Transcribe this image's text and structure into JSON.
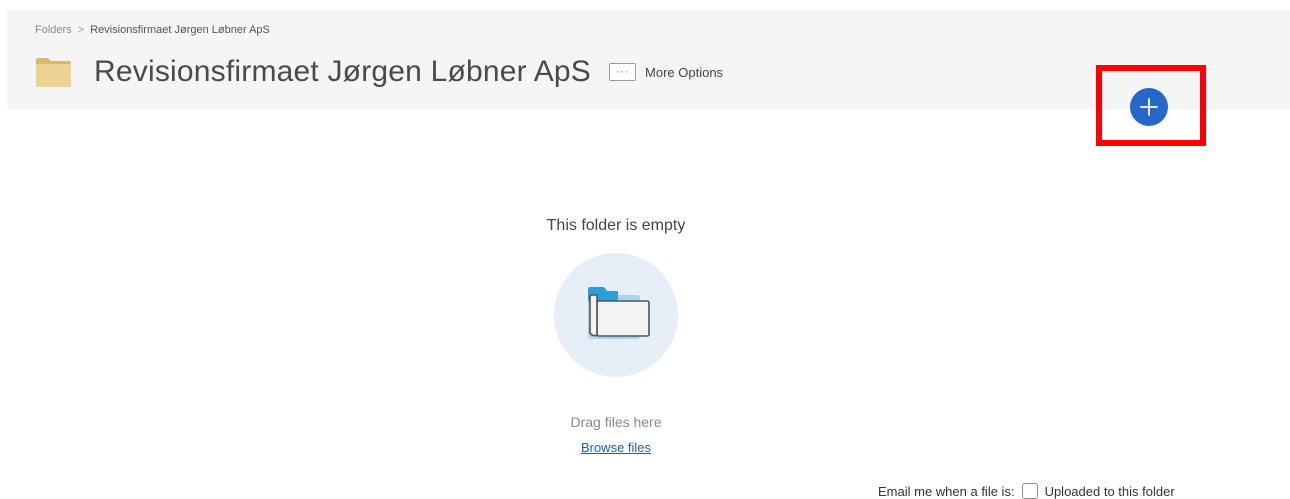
{
  "breadcrumb": {
    "root": "Folders",
    "separator": ">",
    "current": "Revisionsfirmaet Jørgen Løbner ApS"
  },
  "header": {
    "title": "Revisionsfirmaet Jørgen Løbner ApS",
    "title_icon": "folder-icon",
    "more_options_icon": "ellipsis-icon",
    "more_options_dots": "···",
    "more_options_label": "More Options",
    "add_icon": "plus-icon"
  },
  "empty_state": {
    "title": "This folder is empty",
    "illustration_icon": "empty-folder-icon",
    "drag_text": "Drag files here",
    "browse_label": "Browse files"
  },
  "notification": {
    "label": "Email me when a file is:",
    "option_label": "Uploaded to this folder",
    "checked": false
  },
  "colors": {
    "accent": "#2568c7",
    "highlight": "#ff0000",
    "header_bg": "#f5f5f5",
    "folder": "#e8cb86",
    "link": "#1f5fbf"
  }
}
